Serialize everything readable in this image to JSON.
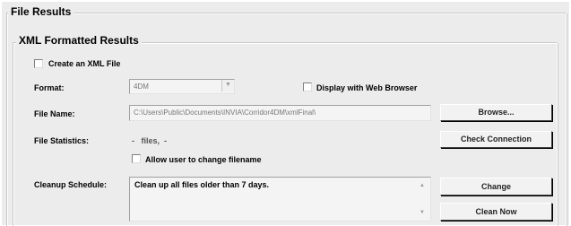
{
  "file_results": {
    "title": "File Results"
  },
  "xml_results": {
    "title": "XML Formatted Results",
    "create_xml_label": "Create an XML File",
    "format_label": "Format:",
    "format_value": "4DM",
    "display_web_label": "Display with Web Browser",
    "file_name_label": "File Name:",
    "file_name_value": "C:\\Users\\Public\\Documents\\INVIA\\Corridor4DM\\xmlFinal\\",
    "browse_label": "Browse...",
    "file_stats_label": "File Statistics:",
    "file_stats_value": "-   files,  -",
    "check_connection_label": "Check Connection",
    "allow_change_label": "Allow user to change filename",
    "cleanup_label": "Cleanup Schedule:",
    "cleanup_text": "Clean up all files older than 7 days.",
    "change_label": "Change",
    "clean_now_label": "Clean Now"
  },
  "icons": {
    "up": "scroll-up-icon",
    "down": "scroll-down-icon",
    "dropdown": "chevron-down-icon"
  }
}
